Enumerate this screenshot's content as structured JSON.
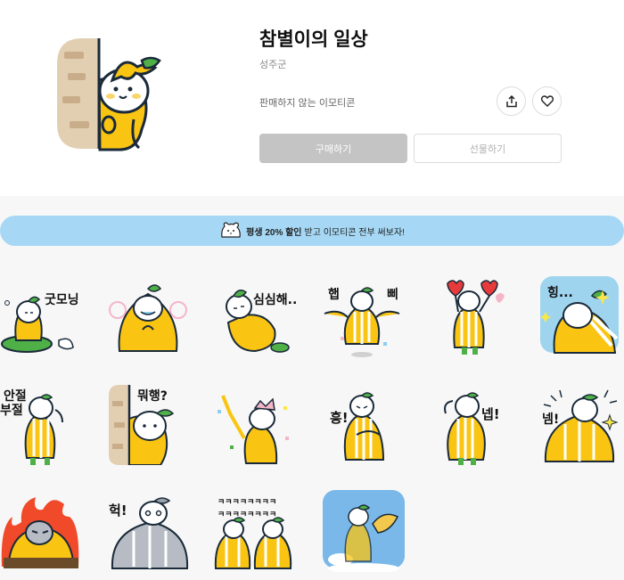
{
  "product": {
    "title": "참별이의 일상",
    "author": "성주군",
    "status": "판매하지 않는 이모티콘",
    "buy_label": "구매하기",
    "gift_label": "선물하기",
    "share_icon": "share-icon",
    "like_icon": "heart-icon"
  },
  "banner": {
    "highlight": "평생 20% 할인",
    "rest": "받고 이모티콘 전부 써보자!"
  },
  "stickers": [
    {
      "text": "굿모닝"
    },
    {
      "text": ""
    },
    {
      "text": "심심해.."
    },
    {
      "text": "햅",
      "text2": "삐"
    },
    {
      "text": ""
    },
    {
      "text": "힝..."
    },
    {
      "text": "안절",
      "text2": "부절"
    },
    {
      "text": "뭐행?"
    },
    {
      "text": ""
    },
    {
      "text": "흥!"
    },
    {
      "text": "넵!"
    },
    {
      "text": "넴!"
    },
    {
      "text": ""
    },
    {
      "text": "헉!"
    },
    {
      "text": "ㅋㅋㅋㅋㅋㅋㅋㅋ",
      "text2": "ㅋㅋㅋㅋㅋㅋㅋㅋ"
    },
    {
      "text": ""
    }
  ],
  "colors": {
    "yellow": "#f9c512",
    "banner": "#a6d8f5",
    "buy_disabled": "#c4c4c4"
  }
}
